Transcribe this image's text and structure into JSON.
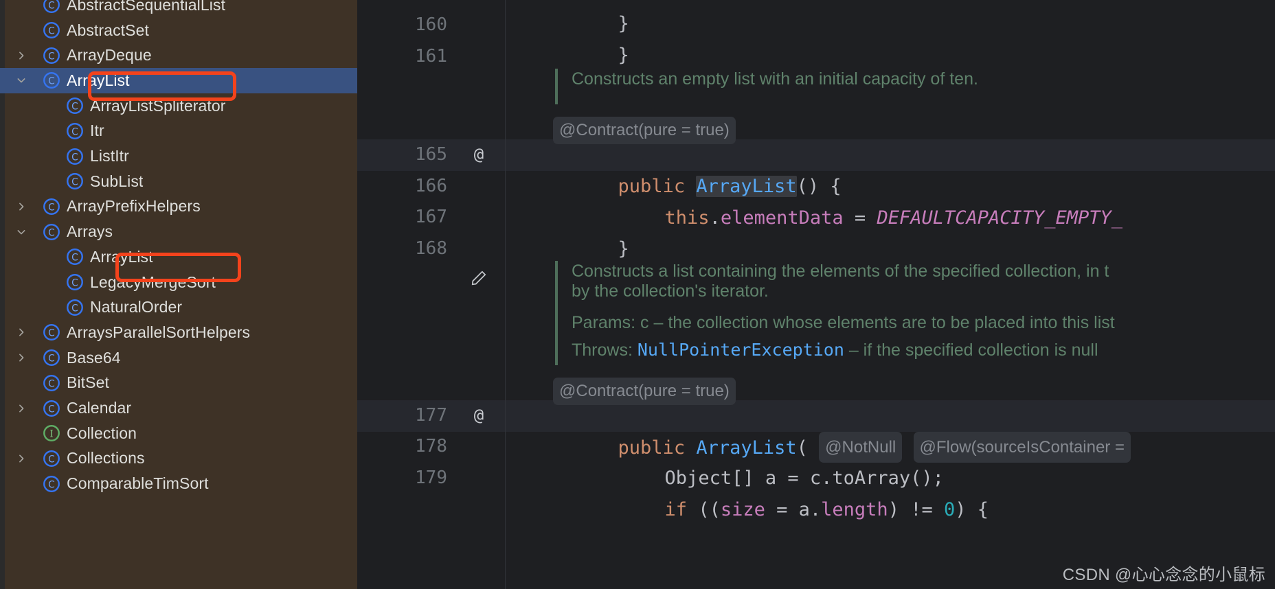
{
  "sidebar": {
    "background_color": "#3e3226",
    "selected_color": "#395281",
    "annotation_color": "#f4431c",
    "items": [
      {
        "label": "AbstractSequentialList",
        "icon": "class-icon",
        "indent": 2,
        "chevron": "none",
        "selected": false
      },
      {
        "label": "AbstractSet",
        "icon": "class-icon",
        "indent": 2,
        "chevron": "none",
        "selected": false
      },
      {
        "label": "ArrayDeque",
        "icon": "class-icon",
        "indent": 2,
        "chevron": "collapsed",
        "selected": false
      },
      {
        "label": "ArrayList",
        "icon": "class-icon",
        "indent": 2,
        "chevron": "expanded",
        "selected": true
      },
      {
        "label": "ArrayListSpliterator",
        "icon": "class-icon",
        "indent": 3,
        "chevron": "none",
        "selected": false
      },
      {
        "label": "Itr",
        "icon": "class-icon",
        "indent": 3,
        "chevron": "none",
        "selected": false
      },
      {
        "label": "ListItr",
        "icon": "class-icon",
        "indent": 3,
        "chevron": "none",
        "selected": false
      },
      {
        "label": "SubList",
        "icon": "class-icon",
        "indent": 3,
        "chevron": "none",
        "selected": false
      },
      {
        "label": "ArrayPrefixHelpers",
        "icon": "class-icon",
        "indent": 2,
        "chevron": "collapsed",
        "selected": false
      },
      {
        "label": "Arrays",
        "icon": "class-icon",
        "indent": 2,
        "chevron": "expanded",
        "selected": false
      },
      {
        "label": "ArrayList",
        "icon": "class-icon",
        "indent": 3,
        "chevron": "none",
        "selected": false
      },
      {
        "label": "LegacyMergeSort",
        "icon": "class-icon",
        "indent": 3,
        "chevron": "none",
        "selected": false
      },
      {
        "label": "NaturalOrder",
        "icon": "class-icon",
        "indent": 3,
        "chevron": "none",
        "selected": false
      },
      {
        "label": "ArraysParallelSortHelpers",
        "icon": "class-icon",
        "indent": 2,
        "chevron": "collapsed",
        "selected": false
      },
      {
        "label": "Base64",
        "icon": "class-icon",
        "indent": 2,
        "chevron": "collapsed",
        "selected": false
      },
      {
        "label": "BitSet",
        "icon": "class-icon",
        "indent": 2,
        "chevron": "none",
        "selected": false
      },
      {
        "label": "Calendar",
        "icon": "class-icon",
        "indent": 2,
        "chevron": "collapsed",
        "selected": false
      },
      {
        "label": "Collection",
        "icon": "interface-icon",
        "indent": 2,
        "chevron": "none",
        "selected": false
      },
      {
        "label": "Collections",
        "icon": "class-icon",
        "indent": 2,
        "chevron": "collapsed",
        "selected": false
      },
      {
        "label": "ComparableTimSort",
        "icon": "class-icon",
        "indent": 2,
        "chevron": "none",
        "selected": false
      }
    ],
    "annotations": [
      {
        "name": "highlight-arraylist-selected",
        "target": "ArrayList"
      },
      {
        "name": "highlight-arrays-arraylist",
        "target": "ArrayList"
      }
    ]
  },
  "editor": {
    "background_color": "#1e1f22",
    "highlight_line_color": "#26282e",
    "gutter": {
      "line_numbers": [
        "160",
        "161",
        "165",
        "166",
        "167",
        "168",
        "177",
        "178",
        "179"
      ],
      "override_marker": "@",
      "edit_marker": "pencil-icon"
    },
    "lines": {
      "l159_close": "}",
      "l160": "}",
      "doc1": "Constructs an empty list with an initial capacity of ten.",
      "hint_contract_1": "@Contract(pure = true)",
      "l165_a": "public ",
      "l165_type": "ArrayList",
      "l165_b": "() {",
      "l166_this": "this",
      "l166_dot": ".",
      "l166_field": "elementData",
      "l166_eq": " = ",
      "l166_const": "DEFAULTCAPACITY_EMPTY_",
      "l167": "}",
      "doc2_line1": "Constructs a list containing the elements of the specified collection, in t",
      "doc2_line2": "by the collection's iterator.",
      "doc2_params_label": "Params:",
      "doc2_params_text": " c – the collection whose elements are to be placed into this list",
      "doc2_throws_label": "Throws:",
      "doc2_throws_type": "NullPointerException",
      "doc2_throws_text": " – if the specified collection is null",
      "hint_contract_2": "@Contract(pure = true)",
      "l177_a": "public ",
      "l177_type": "ArrayList",
      "l177_paren": "( ",
      "hint_notnull": "@NotNull",
      "hint_flow": "@Flow(sourceIsContainer =",
      "l178_a": "Object[] a = c.toArray();",
      "l179_if": "if",
      "l179_b": " ((",
      "l179_size": "size",
      "l179_c": " = a.",
      "l179_length": "length",
      "l179_d": ") != ",
      "l179_zero": "0",
      "l179_e": ") {"
    }
  },
  "watermark": {
    "text": "CSDN @心心念念的小鼠标"
  }
}
